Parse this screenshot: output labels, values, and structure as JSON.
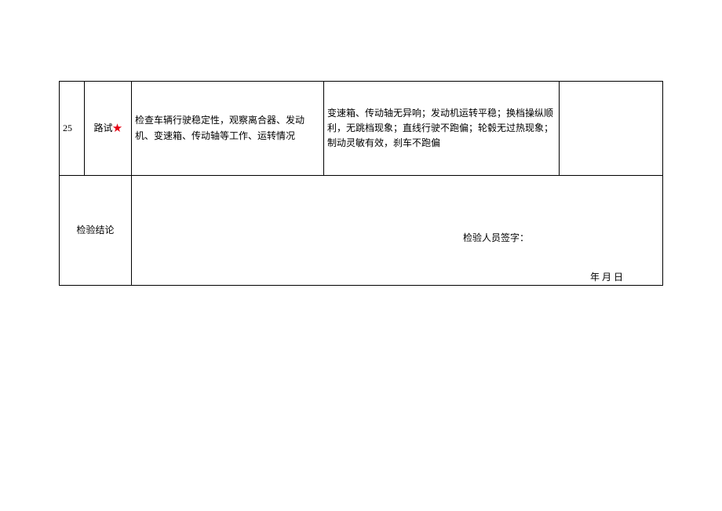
{
  "row": {
    "num": "25",
    "item": "路试",
    "star": "★",
    "method": "检查车辆行驶稳定性，观察离合器、发动机、变速箱、传动轴等工作、运转情况",
    "requirement": "变速箱、传动轴无异响；发动机运转平稳；换档操纵顺利，无跳档现象；直线行驶不跑偏；轮毂无过热现象；制动灵敏有效，刹车不跑偏"
  },
  "conclusion": {
    "label": "检验结论",
    "signature_label": "检验人员签字：",
    "date_label": "年 月 日"
  }
}
